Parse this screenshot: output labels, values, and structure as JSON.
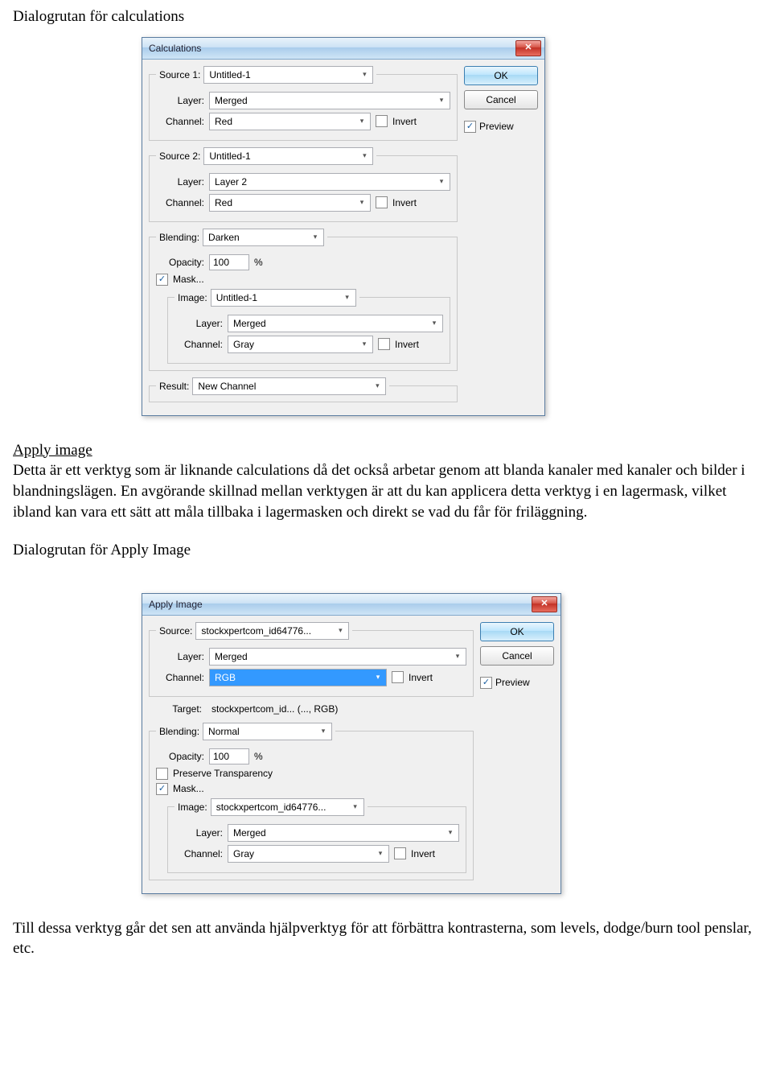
{
  "doc": {
    "heading1": "Dialogrutan för calculations",
    "heading2": "Apply image",
    "para1": "Detta är ett verktyg som är liknande calculations då det också arbetar genom att blanda kanaler med kanaler och bilder i blandningslägen. En avgörande skillnad mellan verktygen är att du kan applicera detta verktyg i en lagermask, vilket ibland kan vara ett sätt att måla tillbaka i lagermasken och direkt se vad du får för friläggning.",
    "heading3": "Dialogrutan för Apply Image",
    "para2": "Till dessa verktyg går det sen att använda hjälpverktyg för att förbättra kontrasterna, som levels, dodge/burn tool penslar, etc."
  },
  "common": {
    "ok": "OK",
    "cancel": "Cancel",
    "preview": "Preview",
    "invert": "Invert",
    "layer": "Layer:",
    "channel": "Channel:",
    "blending": "Blending:",
    "opacity": "Opacity:",
    "percent": "%",
    "mask": "Mask...",
    "image": "Image:",
    "result": "Result:",
    "source": "Source:",
    "target": "Target:",
    "preserve": "Preserve Transparency"
  },
  "calc": {
    "title": "Calculations",
    "source1": {
      "legend": "Source 1:",
      "value": "Untitled-1",
      "layer": "Merged",
      "channel": "Red"
    },
    "source2": {
      "legend": "Source 2:",
      "value": "Untitled-1",
      "layer": "Layer 2",
      "channel": "Red"
    },
    "blending": "Darken",
    "opacity": "100",
    "mask": {
      "image": "Untitled-1",
      "layer": "Merged",
      "channel": "Gray"
    },
    "result": "New Channel"
  },
  "apply": {
    "title": "Apply Image",
    "source": "stockxpertcom_id64776...",
    "layer": "Merged",
    "channel": "RGB",
    "target": "stockxpertcom_id... (..., RGB)",
    "blending": "Normal",
    "opacity": "100",
    "mask": {
      "image": "stockxpertcom_id64776...",
      "layer": "Merged",
      "channel": "Gray"
    }
  }
}
